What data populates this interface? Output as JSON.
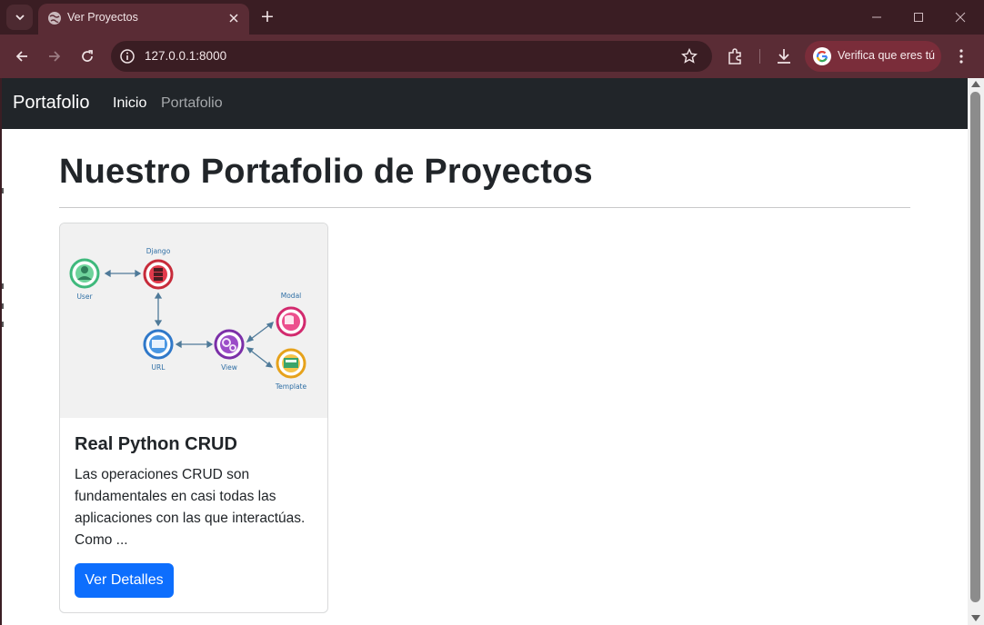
{
  "browser": {
    "tab_title": "Ver Proyectos",
    "new_tab_symbol": "+",
    "url": "127.0.0.1:8000",
    "profile_label": "Verifica que eres tú"
  },
  "site": {
    "brand": "Portafolio",
    "nav": [
      {
        "label": "Inicio",
        "active": true
      },
      {
        "label": "Portafolio",
        "active": false
      }
    ]
  },
  "page": {
    "heading": "Nuestro Portafolio de Proyectos"
  },
  "cards": [
    {
      "title": "Real Python CRUD",
      "text": "Las operaciones CRUD son fundamentales en casi todas las aplicaciones con las que interactúas. Como ...",
      "button": "Ver Detalles",
      "diagram": {
        "nodes": [
          "User",
          "Django",
          "URL",
          "View",
          "Modal",
          "Template"
        ]
      }
    }
  ],
  "colors": {
    "browser_frame": "#3a1d23",
    "browser_toolbar": "#5a2c35",
    "navbar": "#212529",
    "primary_button": "#0d6efd"
  }
}
